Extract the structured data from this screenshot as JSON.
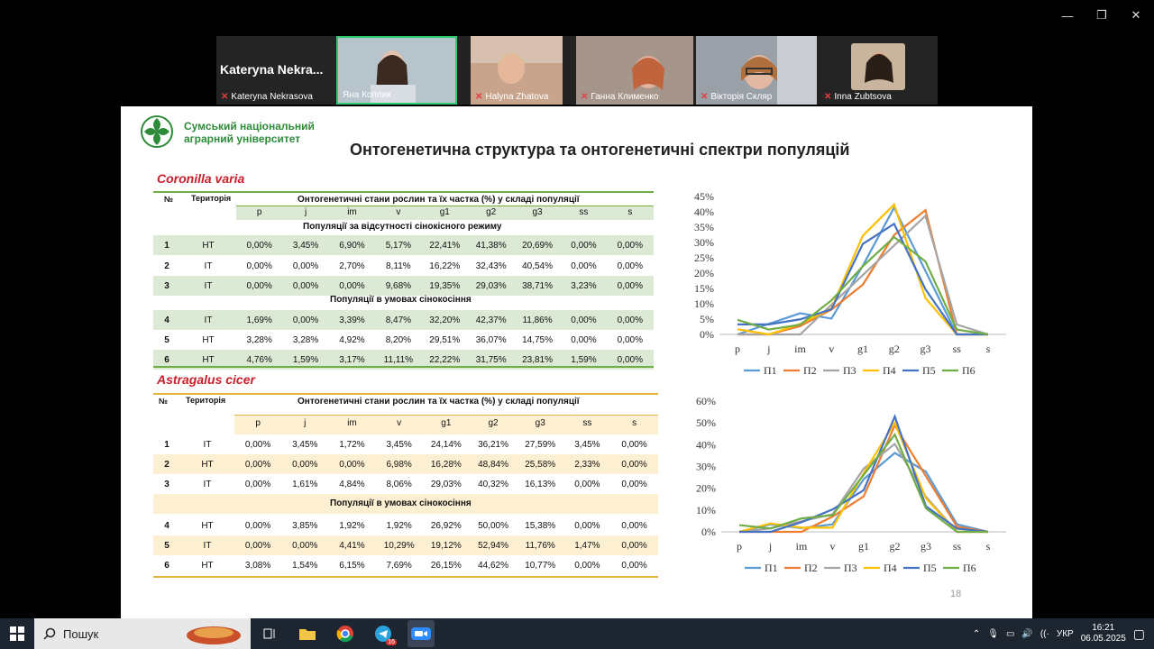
{
  "participants": [
    {
      "name": "Kateryna Nekrasova",
      "big_name": "Kateryna  Nekra...",
      "muted": true
    },
    {
      "name": "Яна Коплик",
      "muted": false,
      "active": true
    },
    {
      "name": "Halyna Zhatova",
      "muted": true
    },
    {
      "name": "Ганна Клименко",
      "muted": true
    },
    {
      "name": "Вікторія Скляр",
      "muted": true
    },
    {
      "name": "Inna Zubtsova",
      "muted": true
    }
  ],
  "slide": {
    "logo_line1": "Сумський національний",
    "logo_line2": "аграрний університет",
    "title": "Онтогенетична структура та онтогенетичні спектри популяцій",
    "page_number": "18",
    "colors": {
      "species": "#c8202a",
      "table1_band": "#dbe9d5",
      "table2_band": "#fdf0d2",
      "table1_rule": "#70ad47",
      "table2_rule": "#e2b63c"
    },
    "table1": {
      "species": "Coronilla varia",
      "no_header": "№",
      "territory_header": "Територія",
      "caption": "Онтогенетичні стани рослин та їх частка (%) у складі популяції",
      "columns": [
        "p",
        "j",
        "im",
        "v",
        "g1",
        "g2",
        "g3",
        "ss",
        "s"
      ],
      "group1": "Популяції за відсутності сінокісного режиму",
      "group2": "Популяції в умовах сінокосіння",
      "rows": [
        [
          "1",
          "НТ",
          "0,00%",
          "3,45%",
          "6,90%",
          "5,17%",
          "22,41%",
          "41,38%",
          "20,69%",
          "0,00%",
          "0,00%"
        ],
        [
          "2",
          "IT",
          "0,00%",
          "0,00%",
          "2,70%",
          "8,11%",
          "16,22%",
          "32,43%",
          "40,54%",
          "0,00%",
          "0,00%"
        ],
        [
          "3",
          "IT",
          "0,00%",
          "0,00%",
          "0,00%",
          "9,68%",
          "19,35%",
          "29,03%",
          "38,71%",
          "3,23%",
          "0,00%"
        ],
        [
          "4",
          "IT",
          "1,69%",
          "0,00%",
          "3,39%",
          "8,47%",
          "32,20%",
          "42,37%",
          "11,86%",
          "0,00%",
          "0,00%"
        ],
        [
          "5",
          "НТ",
          "3,28%",
          "3,28%",
          "4,92%",
          "8,20%",
          "29,51%",
          "36,07%",
          "14,75%",
          "0,00%",
          "0,00%"
        ],
        [
          "6",
          "НТ",
          "4,76%",
          "1,59%",
          "3,17%",
          "11,11%",
          "22,22%",
          "31,75%",
          "23,81%",
          "1,59%",
          "0,00%"
        ]
      ]
    },
    "table2": {
      "species": "Astragalus cicer",
      "no_header": "№",
      "territory_header": "Територія",
      "caption": "Онтогенетичні стани рослин та їх частка (%) у складі популяції",
      "columns": [
        "p",
        "j",
        "im",
        "v",
        "g1",
        "g2",
        "g3",
        "ss",
        "s"
      ],
      "group2": "Популяції в умовах сінокосіння",
      "rows": [
        [
          "1",
          "IT",
          "0,00%",
          "3,45%",
          "1,72%",
          "3,45%",
          "24,14%",
          "36,21%",
          "27,59%",
          "3,45%",
          "0,00%"
        ],
        [
          "2",
          "НТ",
          "0,00%",
          "0,00%",
          "0,00%",
          "6,98%",
          "16,28%",
          "48,84%",
          "25,58%",
          "2,33%",
          "0,00%"
        ],
        [
          "3",
          "IT",
          "0,00%",
          "1,61%",
          "4,84%",
          "8,06%",
          "29,03%",
          "40,32%",
          "16,13%",
          "0,00%",
          "0,00%"
        ],
        [
          "4",
          "НТ",
          "0,00%",
          "3,85%",
          "1,92%",
          "1,92%",
          "26,92%",
          "50,00%",
          "15,38%",
          "0,00%",
          "0,00%"
        ],
        [
          "5",
          "IT",
          "0,00%",
          "0,00%",
          "4,41%",
          "10,29%",
          "19,12%",
          "52,94%",
          "11,76%",
          "1,47%",
          "0,00%"
        ],
        [
          "6",
          "НТ",
          "3,08%",
          "1,54%",
          "6,15%",
          "7,69%",
          "26,15%",
          "44,62%",
          "10,77%",
          "0,00%",
          "0,00%"
        ]
      ]
    }
  },
  "chart_data": [
    {
      "type": "line",
      "categories": [
        "p",
        "j",
        "im",
        "v",
        "g1",
        "g2",
        "g3",
        "ss",
        "s"
      ],
      "yticks": [
        "0%",
        "5%",
        "10%",
        "15%",
        "20%",
        "25%",
        "30%",
        "35%",
        "40%",
        "45%"
      ],
      "ylim": [
        0,
        45
      ],
      "legend": "bottom",
      "series": [
        {
          "name": "П1",
          "color": "#5b9bd5",
          "values": [
            0,
            3.45,
            6.9,
            5.17,
            22.41,
            41.38,
            20.69,
            0,
            0
          ]
        },
        {
          "name": "П2",
          "color": "#ed7d31",
          "values": [
            0,
            0,
            2.7,
            8.11,
            16.22,
            32.43,
            40.54,
            0,
            0
          ]
        },
        {
          "name": "П3",
          "color": "#a5a5a5",
          "values": [
            0,
            0,
            0,
            9.68,
            19.35,
            29.03,
            38.71,
            3.23,
            0
          ]
        },
        {
          "name": "П4",
          "color": "#ffc000",
          "values": [
            1.69,
            0,
            3.39,
            8.47,
            32.2,
            42.37,
            11.86,
            0,
            0
          ]
        },
        {
          "name": "П5",
          "color": "#4472c4",
          "values": [
            3.28,
            3.28,
            4.92,
            8.2,
            29.51,
            36.07,
            14.75,
            0,
            0
          ]
        },
        {
          "name": "П6",
          "color": "#70ad47",
          "values": [
            4.76,
            1.59,
            3.17,
            11.11,
            22.22,
            31.75,
            23.81,
            1.59,
            0
          ]
        }
      ]
    },
    {
      "type": "line",
      "categories": [
        "p",
        "j",
        "im",
        "v",
        "g1",
        "g2",
        "g3",
        "ss",
        "s"
      ],
      "yticks": [
        "0%",
        "10%",
        "20%",
        "30%",
        "40%",
        "50%",
        "60%"
      ],
      "ylim": [
        0,
        60
      ],
      "legend": "bottom",
      "series": [
        {
          "name": "П1",
          "color": "#5b9bd5",
          "values": [
            0,
            3.45,
            1.72,
            3.45,
            24.14,
            36.21,
            27.59,
            3.45,
            0
          ]
        },
        {
          "name": "П2",
          "color": "#ed7d31",
          "values": [
            0,
            0,
            0,
            6.98,
            16.28,
            48.84,
            25.58,
            2.33,
            0
          ]
        },
        {
          "name": "П3",
          "color": "#a5a5a5",
          "values": [
            0,
            1.61,
            4.84,
            8.06,
            29.03,
            40.32,
            16.13,
            0,
            0
          ]
        },
        {
          "name": "П4",
          "color": "#ffc000",
          "values": [
            0,
            3.85,
            1.92,
            1.92,
            26.92,
            50,
            15.38,
            0,
            0
          ]
        },
        {
          "name": "П5",
          "color": "#4472c4",
          "values": [
            0,
            0,
            4.41,
            10.29,
            19.12,
            52.94,
            11.76,
            1.47,
            0
          ]
        },
        {
          "name": "П6",
          "color": "#70ad47",
          "values": [
            3.08,
            1.54,
            6.15,
            7.69,
            26.15,
            44.62,
            10.77,
            0,
            0
          ]
        }
      ]
    }
  ],
  "taskbar": {
    "search_label": "Пошук",
    "language": "УКР",
    "time": "16:21",
    "date": "06.05.2025",
    "telegram_badge": "16"
  }
}
